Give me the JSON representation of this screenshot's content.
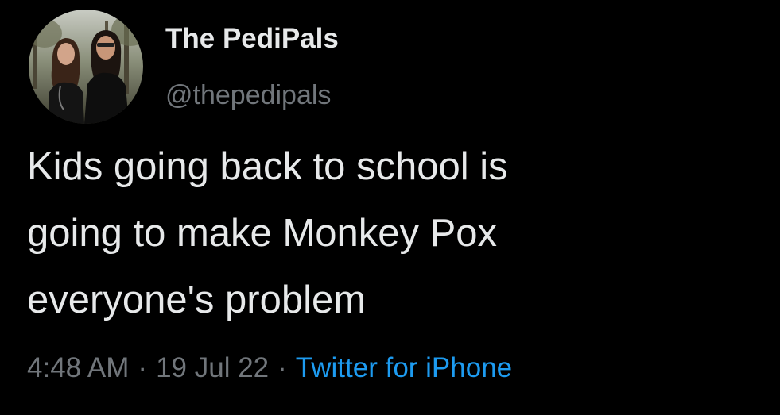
{
  "author": {
    "display_name": "The PediPals",
    "handle": "@thepedipals",
    "avatar_icon": "profile-photo-avatar"
  },
  "tweet": {
    "lines": [
      "Kids going back to school is",
      "going to make Monkey Pox",
      "everyone's problem"
    ]
  },
  "meta": {
    "time": "4:48 AM",
    "separator": "·",
    "date": "19 Jul 22",
    "source": "Twitter for iPhone"
  },
  "colors": {
    "background": "#000000",
    "primary_text": "#e7e9ea",
    "secondary_text": "#71767b",
    "link": "#1d9bf0"
  }
}
